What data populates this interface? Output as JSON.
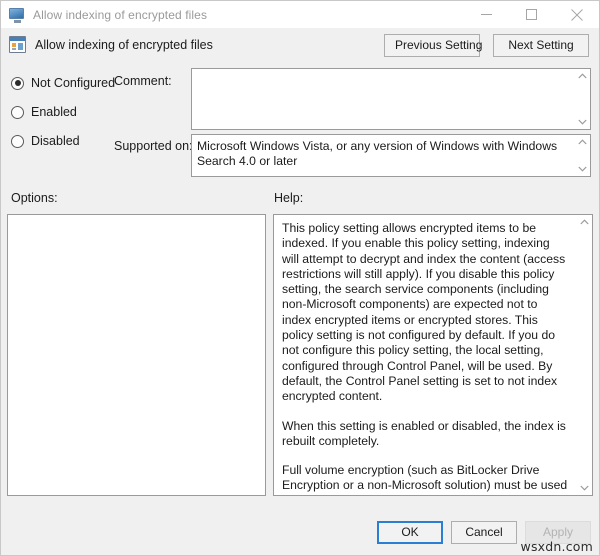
{
  "window": {
    "title": "Allow indexing of encrypted files",
    "icon": "monitor-icon",
    "controls": {
      "minimize": "Minimize",
      "maximize": "Maximize",
      "close": "Close"
    }
  },
  "header": {
    "title": "Allow indexing of encrypted files",
    "icon": "policy-setting-icon",
    "previous_setting_label": "Previous Setting",
    "next_setting_label": "Next Setting"
  },
  "state": {
    "options": [
      {
        "label": "Not Configured",
        "selected": true
      },
      {
        "label": "Enabled",
        "selected": false
      },
      {
        "label": "Disabled",
        "selected": false
      }
    ]
  },
  "comment": {
    "label": "Comment:",
    "value": ""
  },
  "supported_on": {
    "label": "Supported on:",
    "value": "Microsoft Windows Vista, or any version of Windows with Windows Search 4.0 or later"
  },
  "options_panel": {
    "label": "Options:",
    "value": ""
  },
  "help_panel": {
    "label": "Help:",
    "paragraphs": [
      "This policy setting allows encrypted items to be indexed. If you enable this policy setting, indexing  will attempt to decrypt and index the content (access restrictions will still apply). If you disable this policy setting, the search service components (including non-Microsoft components) are expected not to index encrypted items or encrypted stores. This policy setting is not configured by default. If you do not configure this policy setting, the local setting, configured through Control Panel, will be used. By default, the Control Panel setting is set to not index encrypted content.",
      "When this setting is enabled or disabled, the index is rebuilt completely.",
      "Full volume encryption (such as BitLocker Drive Encryption or a non-Microsoft solution) must be used for the location of the index to maintain security for encrypted files."
    ]
  },
  "footer": {
    "ok_label": "OK",
    "cancel_label": "Cancel",
    "apply_label": "Apply",
    "apply_disabled": true
  },
  "watermark": {
    "text": "wsxdn.com"
  },
  "colors": {
    "window_bg": "#f0f0f0",
    "titlebar_bg": "#ffffff",
    "border": "#9a9a9a",
    "focus_blue": "#2a7fd4",
    "disabled_text": "#b3b3b3"
  }
}
